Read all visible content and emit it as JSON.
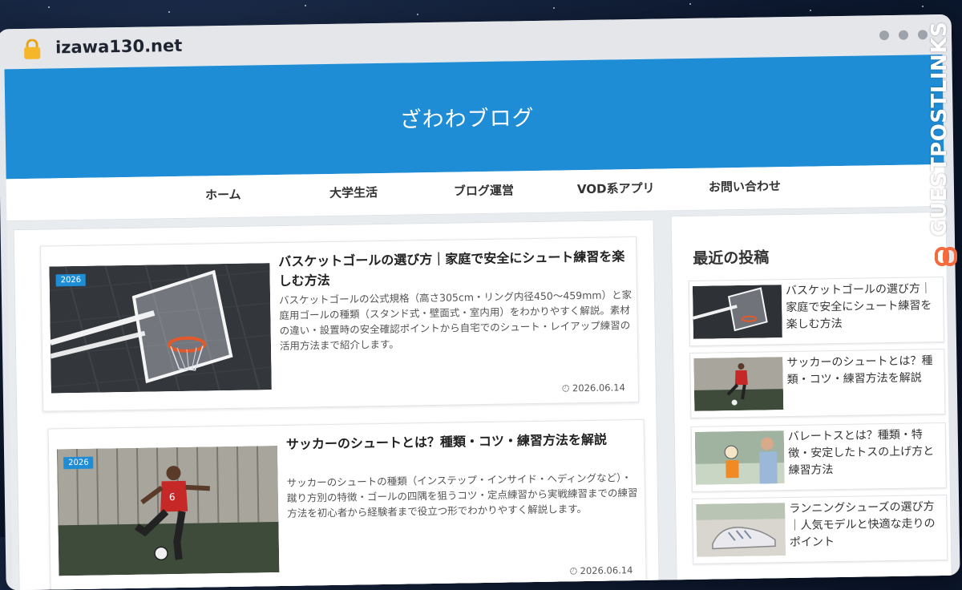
{
  "browser": {
    "url": "izawa130.net"
  },
  "site": {
    "title": "ざわわブログ",
    "nav": [
      "ホーム",
      "大学生活",
      "ブログ運営",
      "VOD系アプリ",
      "お問い合わせ"
    ],
    "accent_color": "#1f8dd6"
  },
  "posts": [
    {
      "badge": "2026",
      "title": "バスケットゴールの選び方｜家庭で安全にシュート練習を楽しむ方法",
      "excerpt": "バスケットゴールの公式規格（高さ305cm・リング内径450〜459mm）と家庭用ゴールの種類（スタンド式・壁面式・室内用）をわかりやすく解説。素材の違い・設置時の安全確認ポイントから自宅でのシュート・レイアップ練習の活用方法まで紹介します。",
      "date": "2026.06.14",
      "thumbnail": "basketball-hoop"
    },
    {
      "badge": "2026",
      "title": "サッカーのシュートとは？種類・コツ・練習方法を解説",
      "excerpt": "サッカーのシュートの種類（インステップ・インサイド・ヘディングなど）・蹴り方別の特徴・ゴールの四隅を狙うコツ・定点練習から実戦練習までの練習方法を初心者から経験者まで役立つ形でわかりやすく解説します。",
      "date": "2026.06.14",
      "thumbnail": "soccer-player"
    }
  ],
  "sidebar": {
    "heading": "最近の投稿",
    "items": [
      {
        "title": "バスケットゴールの選び方｜家庭で安全にシュート練習を楽しむ方法",
        "thumbnail": "basketball-hoop"
      },
      {
        "title": "サッカーのシュートとは？種類・コツ・練習方法を解説",
        "thumbnail": "soccer-player"
      },
      {
        "title": "バレートスとは？種類・特徴・安定したトスの上げ方と練習方法",
        "thumbnail": "volleyball"
      },
      {
        "title": "ランニングシューズの選び方｜人気モデルと快適な走りのポイント",
        "thumbnail": "running-shoes"
      }
    ]
  },
  "watermark": {
    "text": "GUESTPOSTLINKS"
  }
}
